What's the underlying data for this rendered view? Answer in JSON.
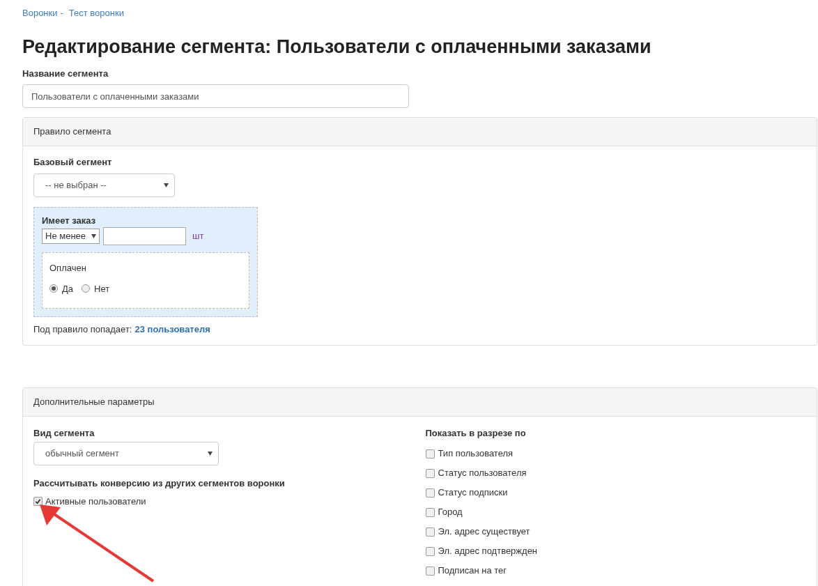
{
  "breadcrumb": [
    {
      "label": "Воронки",
      "separator": "-"
    },
    {
      "label": "Тест воронки"
    }
  ],
  "title": "Редактирование сегмента: Пользователи с оплаченными заказами",
  "name_field": {
    "label": "Название сегмента",
    "value": "Пользователи с оплаченными заказами"
  },
  "rule_panel": {
    "header": "Правило сегмента",
    "base_segment": {
      "label": "Базовый сегмент",
      "value": "-- не выбран --"
    },
    "condition": {
      "title": "Имеет заказ",
      "operator": "Не менее",
      "unit": "шт",
      "sub": {
        "label": "Оплачен",
        "options": [
          {
            "label": "Да",
            "selected": true
          },
          {
            "label": "Нет",
            "selected": false
          }
        ]
      }
    },
    "result": {
      "text": "Под правило попадает:",
      "link": "23 пользователя"
    }
  },
  "extra_panel": {
    "header": "Дополнительные параметры",
    "segment_type": {
      "label": "Вид сегмента",
      "value": "обычный сегмент"
    },
    "conversion": {
      "label": "Рассчитывать конверсию из других сегментов воронки",
      "items": [
        {
          "label": "Активные пользователи",
          "checked": true
        }
      ]
    },
    "breakdown": {
      "label": "Показать в разрезе по",
      "items": [
        {
          "label": "Тип пользователя",
          "checked": false
        },
        {
          "label": "Статус пользователя",
          "checked": false
        },
        {
          "label": "Статус подписки",
          "checked": false
        },
        {
          "label": "Город",
          "checked": false
        },
        {
          "label": "Эл. адрес существует",
          "checked": false
        },
        {
          "label": "Эл. адрес подтвержден",
          "checked": false
        },
        {
          "label": "Подписан на тег",
          "checked": false
        }
      ]
    }
  }
}
